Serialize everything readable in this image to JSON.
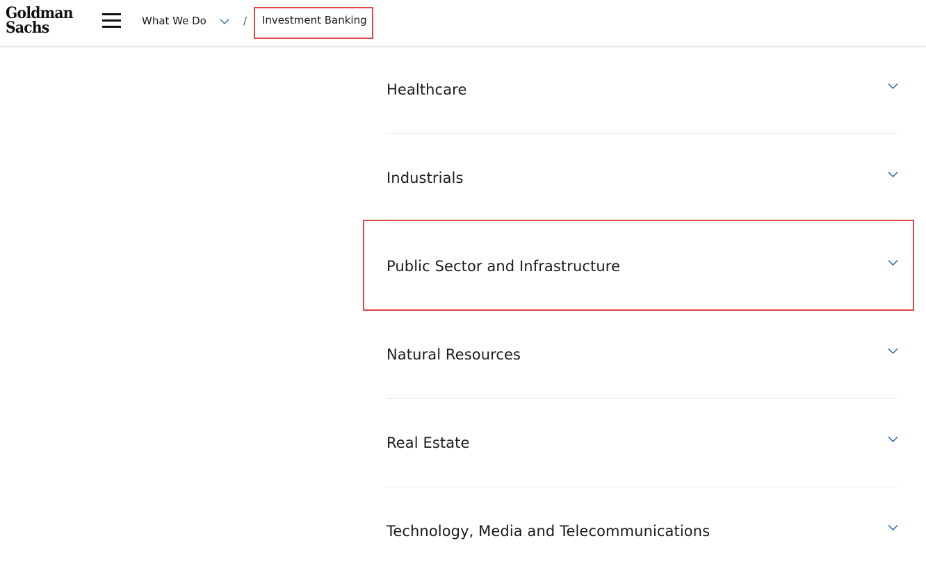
{
  "header": {
    "logo": {
      "line1": "Goldman",
      "line2": "Sachs"
    },
    "menu_icon": "hamburger-icon",
    "breadcrumb": {
      "parent": "What We Do",
      "separator": "/",
      "current": "Investment Banking"
    }
  },
  "accordion": {
    "items": [
      {
        "label": "Healthcare"
      },
      {
        "label": "Industrials"
      },
      {
        "label": "Public Sector and Infrastructure"
      },
      {
        "label": "Natural Resources"
      },
      {
        "label": "Real Estate"
      },
      {
        "label": "Technology, Media and Telecommunications"
      }
    ],
    "chevron_icon": "chevron-down-icon"
  },
  "colors": {
    "accent_chevron": "#2e5fa8",
    "highlight": "#e04848",
    "divider": "#e4e4e4"
  }
}
